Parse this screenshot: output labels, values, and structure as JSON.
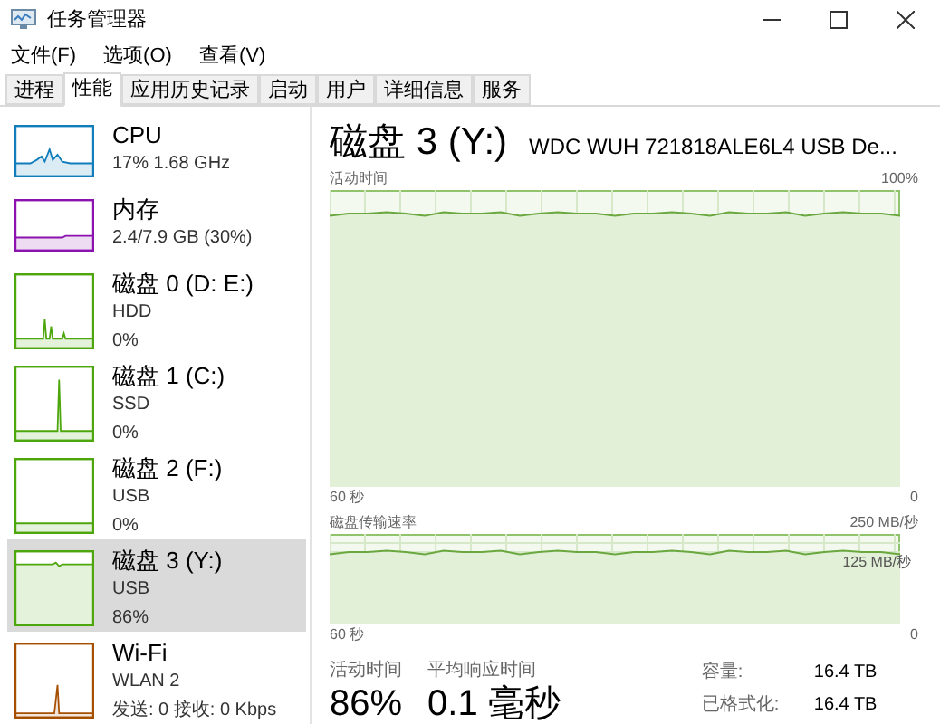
{
  "window": {
    "title": "任务管理器"
  },
  "menu": [
    "文件(F)",
    "选项(O)",
    "查看(V)"
  ],
  "tabs": [
    {
      "label": "进程",
      "selected": false
    },
    {
      "label": "性能",
      "selected": true
    },
    {
      "label": "应用历史记录",
      "selected": false
    },
    {
      "label": "启动",
      "selected": false
    },
    {
      "label": "用户",
      "selected": false
    },
    {
      "label": "详细信息",
      "selected": false
    },
    {
      "label": "服务",
      "selected": false
    }
  ],
  "sidebar": {
    "items": [
      {
        "name": "CPU",
        "lines": [
          "17% 1.68 GHz"
        ],
        "color": "#117dbb",
        "selected": false
      },
      {
        "name": "内存",
        "lines": [
          "2.4/7.9 GB (30%)"
        ],
        "color": "#8b12ae",
        "selected": false
      },
      {
        "name": "磁盘 0 (D: E:)",
        "lines": [
          "HDD",
          "0%"
        ],
        "color": "#4da60c",
        "selected": false
      },
      {
        "name": "磁盘 1 (C:)",
        "lines": [
          "SSD",
          "0%"
        ],
        "color": "#4da60c",
        "selected": false
      },
      {
        "name": "磁盘 2 (F:)",
        "lines": [
          "USB",
          "0%"
        ],
        "color": "#4da60c",
        "selected": false
      },
      {
        "name": "磁盘 3 (Y:)",
        "lines": [
          "USB",
          "86%"
        ],
        "color": "#4da60c",
        "selected": true
      },
      {
        "name": "Wi-Fi",
        "lines": [
          "WLAN 2",
          "发送: 0 接收: 0 Kbps"
        ],
        "color": "#a74f01",
        "selected": false
      }
    ]
  },
  "detail": {
    "title": "磁盘 3 (Y:)",
    "model": "WDC  WUH 721818ALE6L4 USB De...",
    "activity_graph": {
      "label": "活动时间",
      "max": "100%",
      "time": "60 秒",
      "min": "0"
    },
    "transfer_graph": {
      "label": "磁盘传输速率",
      "max": "250 MB/秒",
      "mid": "125 MB/秒",
      "time": "60 秒",
      "min": "0"
    },
    "stats": [
      {
        "label": "活动时间",
        "value": "86%"
      },
      {
        "label": "平均响应时间",
        "value": "0.1 毫秒"
      }
    ],
    "properties": [
      {
        "label": "容量:",
        "value": "16.4 TB"
      },
      {
        "label": "已格式化:",
        "value": "16.4 TB"
      }
    ]
  }
}
